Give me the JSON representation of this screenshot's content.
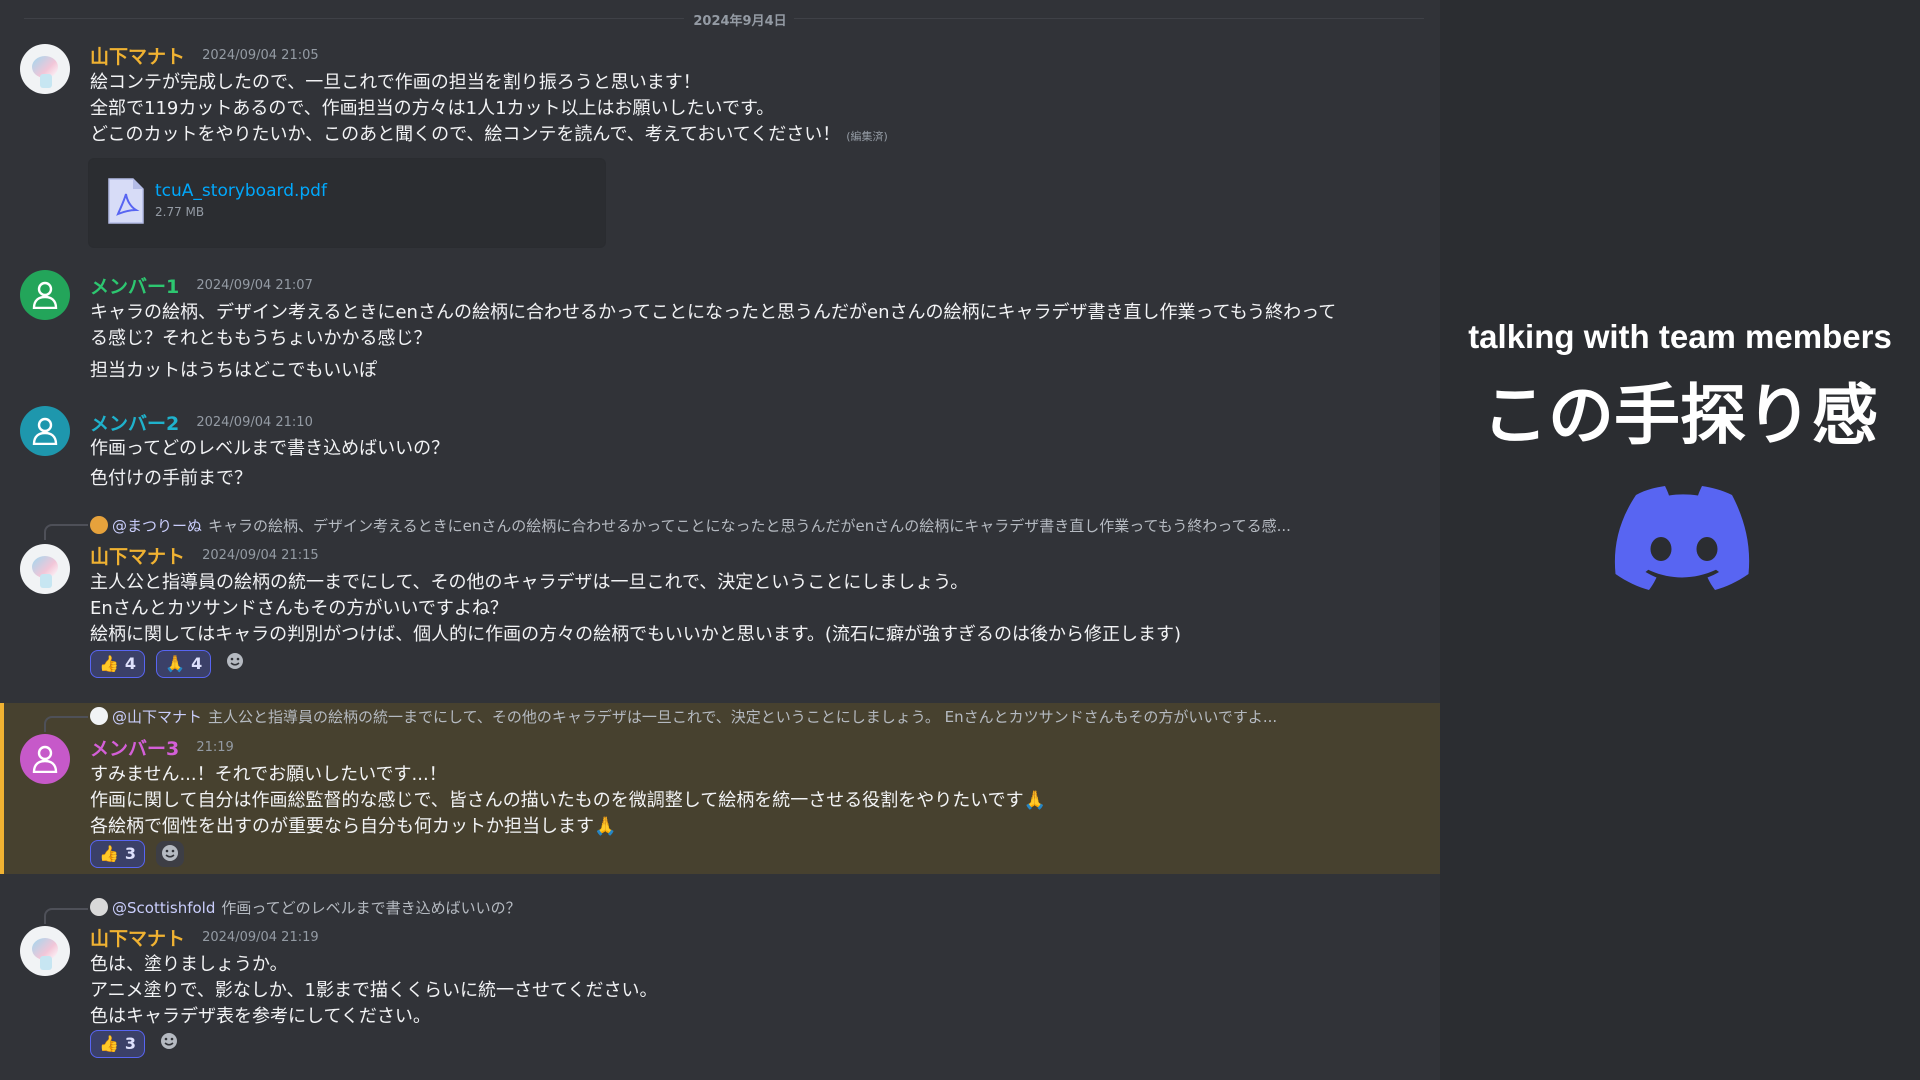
{
  "date_divider": "2024年9月4日",
  "colors": {
    "chat_bg": "#313338",
    "yellow_name": "#f0b232",
    "green_name": "#2dc770",
    "teal_name": "#1fb2cc",
    "pink_name": "#d45fd8",
    "link": "#00a8fc",
    "highlight_bg": "#47412f",
    "discord_blurple": "#5865f2"
  },
  "messages": [
    {
      "author": "山下マナト",
      "timestamp": "2024/09/04 21:05",
      "lines": [
        "絵コンテが完成したので、一旦これで作画の担当を割り振ろうと思います！",
        "全部で119カットあるので、作画担当の方々は1人1カット以上はお願いしたいです。",
        "どこのカットをやりたいか、このあと聞くので、絵コンテを読んで、考えておいてください！"
      ],
      "edited_label": "(編集済)",
      "attachment": {
        "icon": "pdf-file-icon",
        "name": "tcuA_storyboard.pdf",
        "size": "2.77 MB"
      }
    },
    {
      "author": "メンバー1",
      "timestamp": "2024/09/04 21:07",
      "lines": [
        "キャラの絵柄、デザイン考えるときにenさんの絵柄に合わせるかってことになったと思うんだがenさんの絵柄にキャラデザ書き直し作業ってもう終わって",
        "る感じ？それとももうちょいかかる感じ？",
        "担当カットはうちはどこでもいいぽ"
      ]
    },
    {
      "author": "メンバー2",
      "timestamp": "2024/09/04 21:10",
      "lines": [
        "作画ってどのレベルまで書き込めばいいの？",
        "色付けの手前まで？"
      ]
    },
    {
      "reply": {
        "mention": "@まつりーぬ",
        "text": "キャラの絵柄、デザイン考えるときにenさんの絵柄に合わせるかってことになったと思うんだがenさんの絵柄にキャラデザ書き直し作業ってもう終わってる感..."
      },
      "author": "山下マナト",
      "timestamp": "2024/09/04 21:15",
      "lines": [
        "主人公と指導員の絵柄の統一までにして、その他のキャラデザは一旦これで、決定ということにしましょう。",
        "Enさんとカツサンドさんもその方がいいですよね？",
        "絵柄に関してはキャラの判別がつけば、個人的に作画の方々の絵柄でもいいかと思います。(流石に癖が強すぎるのは後から修正します)"
      ],
      "reactions": [
        {
          "emoji": "👍",
          "count": "4",
          "icon": "thumbs-up-icon"
        },
        {
          "emoji": "🙏",
          "count": "4",
          "icon": "folded-hands-icon"
        }
      ]
    },
    {
      "reply": {
        "mention": "@山下マナト",
        "text": "主人公と指導員の絵柄の統一までにして、その他のキャラデザは一旦これで、決定ということにしましょう。 Enさんとカツサンドさんもその方がいいですよ..."
      },
      "author": "メンバー3",
      "timestamp": "21:19",
      "lines": [
        "すみません...！それでお願いしたいです...！",
        "作画に関して自分は作画総監督的な感じで、皆さんの描いたものを微調整して絵柄を統一させる役割をやりたいです🙏",
        "各絵柄で個性を出すのが重要なら自分も何カットか担当します🙏"
      ],
      "reactions": [
        {
          "emoji": "👍",
          "count": "3",
          "icon": "thumbs-up-icon"
        }
      ]
    },
    {
      "reply": {
        "mention": "@Scottishfold",
        "text": "作画ってどのレベルまで書き込めばいいの？"
      },
      "author": "山下マナト",
      "timestamp": "2024/09/04 21:19",
      "lines": [
        "色は、塗りましょうか。",
        "アニメ塗りで、影なしか、1影まで描くくらいに統一させてください。",
        "色はキャラデザ表を参考にしてください。"
      ],
      "reactions": [
        {
          "emoji": "👍",
          "count": "3",
          "icon": "thumbs-up-icon"
        }
      ]
    }
  ],
  "side_panel": {
    "caption_en": "talking with team members",
    "caption_jp": "この手探り感",
    "logo": "discord-logo-icon"
  }
}
